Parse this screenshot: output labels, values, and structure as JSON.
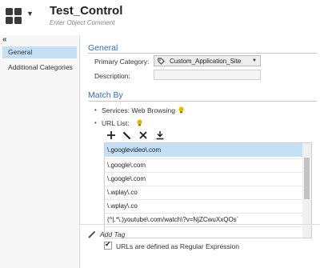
{
  "header": {
    "title": "Test_Control",
    "comment_placeholder": "Enter Object Comment"
  },
  "sidebar": {
    "collapse_glyph": "«",
    "items": [
      {
        "label": "General",
        "active": true
      },
      {
        "label": "Additional Categories",
        "active": false
      }
    ]
  },
  "general": {
    "section_title": "General",
    "primary_category_label": "Primary Category:",
    "primary_category_value": "Custom_Application_Site",
    "description_label": "Description:",
    "description_value": ""
  },
  "match_by": {
    "section_title": "Match By",
    "services_label": "Services: Web Browsing",
    "url_list_label": "URL List:",
    "toolbar": {
      "add_icon": "plus-icon",
      "edit_icon": "pencil-icon",
      "delete_icon": "x-icon",
      "import_icon": "download-icon"
    },
    "urls": [
      "\\.googlevideo\\.com",
      "\\.google\\.com",
      "\\.google\\.com",
      "\\.wplay\\.co",
      "\\.wplay\\.co",
      "(^|.*\\.)youtube\\.com/watch\\?v=NjZCwuXxQOs`"
    ],
    "selected_index": 0,
    "regex_checkbox_label": "URLs are defined as Regular Expression",
    "regex_checked": true
  },
  "footer": {
    "add_tag_label": "Add Tag"
  },
  "colors": {
    "accent": "#2f6fb2",
    "selection": "#c4e0f7",
    "bulb": "#e5b800"
  }
}
